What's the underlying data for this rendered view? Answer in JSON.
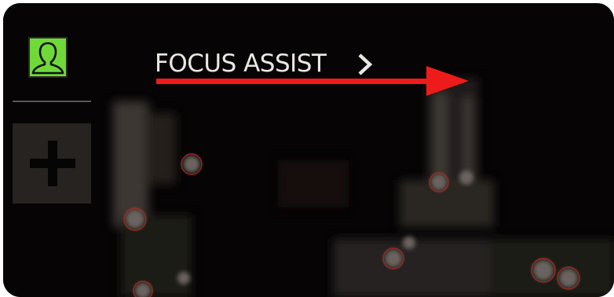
{
  "menu": {
    "item_label": "FOCUS ASSIST"
  },
  "icons": {
    "profile": "user-profile-icon",
    "add": "plus-icon",
    "next": "chevron-right-icon"
  },
  "colors": {
    "profile_accent": "#6fd93a",
    "annotation_arrow": "#ee1b1b",
    "menu_text": "#ece6e2"
  }
}
